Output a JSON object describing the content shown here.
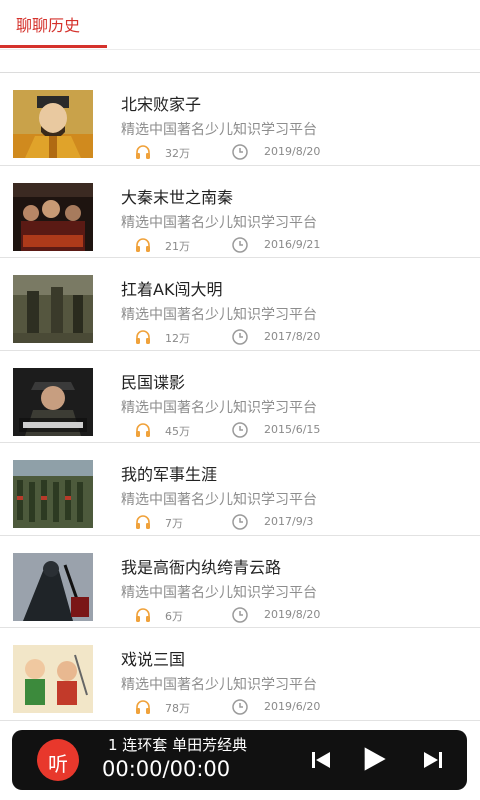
{
  "tab": {
    "label": "聊聊历史"
  },
  "items": [
    {
      "title": "北宋败家子",
      "subtitle": "精选中国著名少儿知识学习平台",
      "plays": "32万",
      "date": "2019/8/20",
      "thumb": "emperor-portrait"
    },
    {
      "title": "大秦末世之南秦",
      "subtitle": "精选中国著名少儿知识学习平台",
      "plays": "21万",
      "date": "2016/9/21",
      "thumb": "drama-poster"
    },
    {
      "title": "扛着AK闯大明",
      "subtitle": "精选中国著名少儿知识学习平台",
      "plays": "12万",
      "date": "2017/8/20",
      "thumb": "soldiers-photo"
    },
    {
      "title": "民国谍影",
      "subtitle": "精选中国著名少儿知识学习平台",
      "plays": "45万",
      "date": "2015/6/15",
      "thumb": "officer-poster"
    },
    {
      "title": "我的军事生涯",
      "subtitle": "精选中国著名少儿知识学习平台",
      "plays": "7万",
      "date": "2017/9/3",
      "thumb": "army-parade"
    },
    {
      "title": "我是高衙内纨绔青云路",
      "subtitle": "精选中国著名少儿知识学习平台",
      "plays": "6万",
      "date": "2019/8/20",
      "thumb": "warrior-art"
    },
    {
      "title": "戏说三国",
      "subtitle": "精选中国著名少儿知识学习平台",
      "plays": "78万",
      "date": "2019/6/20",
      "thumb": "cartoon-figures"
    }
  ],
  "player": {
    "logo": "听",
    "track": "1 连环套  单田芳经典",
    "time": "00:00/00:00",
    "icons": [
      "previous-icon",
      "play-icon",
      "next-icon"
    ]
  },
  "colors": {
    "accent": "#d5322c",
    "player_bg": "#111111",
    "logo_bg": "#e8382c",
    "icon_orange": "#f0a23b"
  }
}
